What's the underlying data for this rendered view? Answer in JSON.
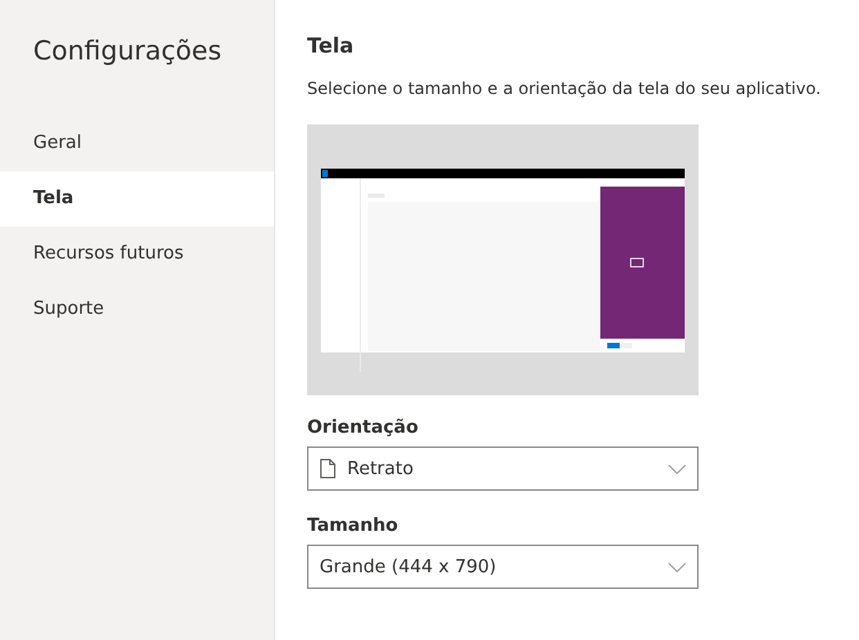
{
  "sidebar": {
    "title": "Configurações",
    "items": [
      {
        "label": "Geral",
        "selected": false
      },
      {
        "label": "Tela",
        "selected": true
      },
      {
        "label": "Recursos futuros",
        "selected": false
      },
      {
        "label": "Suporte",
        "selected": false
      }
    ]
  },
  "main": {
    "title": "Tela",
    "description": "Selecione o tamanho e a orientação da tela do seu aplicativo.",
    "fields": [
      {
        "label": "Orientação",
        "value": "Retrato",
        "kind": "page-icon"
      },
      {
        "label": "Tamanho",
        "value": "Grande (444 x 790)",
        "kind": "plain"
      }
    ]
  }
}
